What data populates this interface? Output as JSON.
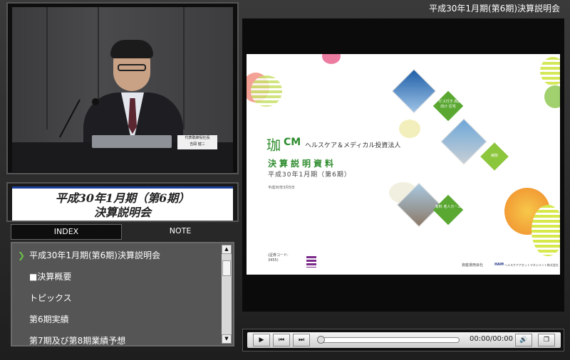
{
  "window": {
    "title": "平成30年1月期(第6期)決算説明会"
  },
  "video": {
    "nameplate_line1": "代表取締役社長",
    "nameplate_line2": "吉岡 健二"
  },
  "info_panel": {
    "title_line1": "平成30年1月期（第6期）",
    "title_line2": "決算説明会"
  },
  "tabs": [
    {
      "label": "INDEX",
      "selected": true
    },
    {
      "label": "NOTE",
      "selected": false
    }
  ],
  "index_list": {
    "items": [
      {
        "label": "平成30年1月期(第6期)決算説明会",
        "current": true
      },
      {
        "label": "■決算概要",
        "current": false
      },
      {
        "label": "トピックス",
        "current": false
      },
      {
        "label": "第6期実績",
        "current": false
      },
      {
        "label": "第7期及び第8期業績予想",
        "current": false
      }
    ],
    "current_marker": "❯"
  },
  "slide": {
    "logo_mark": "珈",
    "logo_text": "CM",
    "company": "ヘルスケア＆メディカル投資法人",
    "title": "決算説明資料",
    "subtitle": "平成30年1月期（第6期）",
    "date": "平成30年3月5日",
    "code_line1": "(証券コード:",
    "code_line2": "3455)",
    "asset_manager": "資産運用会社",
    "ham_logo": "HAM",
    "ham_company": "ヘルスケアアセットマネジメント株式会社",
    "diamond_labels": [
      "サービス付き 高齢者向け 住宅",
      "病院",
      "有料 老人ホーム"
    ],
    "accent_green": "#6bb631"
  },
  "player": {
    "time": "00:00/00:00",
    "progress": 0
  }
}
